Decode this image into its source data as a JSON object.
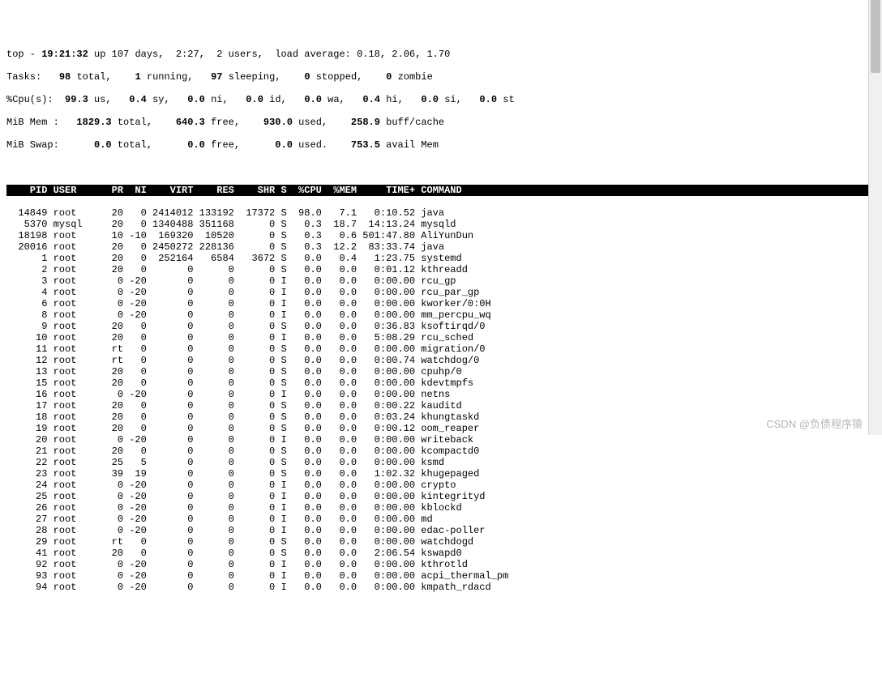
{
  "summary": {
    "line1_a": "top - ",
    "line1_time": "19:21:32",
    "line1_b": " up 107 days,  2:27,  2 users,  load average: 0.18, 2.06, 1.70",
    "tasks_label": "Tasks:",
    "tasks_total": "   98 ",
    "tasks_total_l": "total,",
    "tasks_run": "    1 ",
    "tasks_run_l": "running,",
    "tasks_sleep": "   97 ",
    "tasks_sleep_l": "sleeping,",
    "tasks_stop": "    0 ",
    "tasks_stop_l": "stopped,",
    "tasks_zomb": "    0 ",
    "tasks_zomb_l": "zombie",
    "cpu_label": "%Cpu(s):",
    "cpu_us": "  99.3 ",
    "cpu_us_l": "us,",
    "cpu_sy": "   0.4 ",
    "cpu_sy_l": "sy,",
    "cpu_ni": "   0.0 ",
    "cpu_ni_l": "ni,",
    "cpu_id": "   0.0 ",
    "cpu_id_l": "id,",
    "cpu_wa": "   0.0 ",
    "cpu_wa_l": "wa,",
    "cpu_hi": "   0.4 ",
    "cpu_hi_l": "hi,",
    "cpu_si": "   0.0 ",
    "cpu_si_l": "si,",
    "cpu_st": "   0.0 ",
    "cpu_st_l": "st",
    "mem_label": "MiB Mem :",
    "mem_total": "   1829.3 ",
    "mem_total_l": "total,",
    "mem_free": "    640.3 ",
    "mem_free_l": "free,",
    "mem_used": "    930.0 ",
    "mem_used_l": "used,",
    "mem_buff": "    258.9 ",
    "mem_buff_l": "buff/cache",
    "swap_label": "MiB Swap:",
    "swap_total": "      0.0 ",
    "swap_total_l": "total,",
    "swap_free": "      0.0 ",
    "swap_free_l": "free,",
    "swap_used": "      0.0 ",
    "swap_used_l": "used.",
    "swap_avail": "    753.5 ",
    "swap_avail_l": "avail Mem"
  },
  "columns": "    PID USER      PR  NI    VIRT    RES    SHR S  %CPU  %MEM     TIME+ COMMAND                                                                      ",
  "rows": [
    "  14849 root      20   0 2414012 133192  17372 S  98.0   7.1   0:10.52 java",
    "   5370 mysql     20   0 1340488 351168      0 S   0.3  18.7  14:13.24 mysqld",
    "  18198 root      10 -10  169320  10520      0 S   0.3   0.6 501:47.80 AliYunDun",
    "  20016 root      20   0 2450272 228136      0 S   0.3  12.2  83:33.74 java",
    "      1 root      20   0  252164   6584   3672 S   0.0   0.4   1:23.75 systemd",
    "      2 root      20   0       0      0      0 S   0.0   0.0   0:01.12 kthreadd",
    "      3 root       0 -20       0      0      0 I   0.0   0.0   0:00.00 rcu_gp",
    "      4 root       0 -20       0      0      0 I   0.0   0.0   0:00.00 rcu_par_gp",
    "      6 root       0 -20       0      0      0 I   0.0   0.0   0:00.00 kworker/0:0H",
    "      8 root       0 -20       0      0      0 I   0.0   0.0   0:00.00 mm_percpu_wq",
    "      9 root      20   0       0      0      0 S   0.0   0.0   0:36.83 ksoftirqd/0",
    "     10 root      20   0       0      0      0 I   0.0   0.0   5:08.29 rcu_sched",
    "     11 root      rt   0       0      0      0 S   0.0   0.0   0:00.00 migration/0",
    "     12 root      rt   0       0      0      0 S   0.0   0.0   0:00.74 watchdog/0",
    "     13 root      20   0       0      0      0 S   0.0   0.0   0:00.00 cpuhp/0",
    "     15 root      20   0       0      0      0 S   0.0   0.0   0:00.00 kdevtmpfs",
    "     16 root       0 -20       0      0      0 I   0.0   0.0   0:00.00 netns",
    "     17 root      20   0       0      0      0 S   0.0   0.0   0:00.22 kauditd",
    "     18 root      20   0       0      0      0 S   0.0   0.0   0:03.24 khungtaskd",
    "     19 root      20   0       0      0      0 S   0.0   0.0   0:00.12 oom_reaper",
    "     20 root       0 -20       0      0      0 I   0.0   0.0   0:00.00 writeback",
    "     21 root      20   0       0      0      0 S   0.0   0.0   0:00.00 kcompactd0",
    "     22 root      25   5       0      0      0 S   0.0   0.0   0:00.00 ksmd",
    "     23 root      39  19       0      0      0 S   0.0   0.0   1:02.32 khugepaged",
    "     24 root       0 -20       0      0      0 I   0.0   0.0   0:00.00 crypto",
    "     25 root       0 -20       0      0      0 I   0.0   0.0   0:00.00 kintegrityd",
    "     26 root       0 -20       0      0      0 I   0.0   0.0   0:00.00 kblockd",
    "     27 root       0 -20       0      0      0 I   0.0   0.0   0:00.00 md",
    "     28 root       0 -20       0      0      0 I   0.0   0.0   0:00.00 edac-poller",
    "     29 root      rt   0       0      0      0 S   0.0   0.0   0:00.00 watchdogd",
    "     41 root      20   0       0      0      0 S   0.0   0.0   2:06.54 kswapd0",
    "     92 root       0 -20       0      0      0 I   0.0   0.0   0:00.00 kthrotld",
    "     93 root       0 -20       0      0      0 I   0.0   0.0   0:00.00 acpi_thermal_pm",
    "     94 root       0 -20       0      0      0 I   0.0   0.0   0:00.00 kmpath_rdacd"
  ],
  "watermark": "CSDN @负债程序猿"
}
